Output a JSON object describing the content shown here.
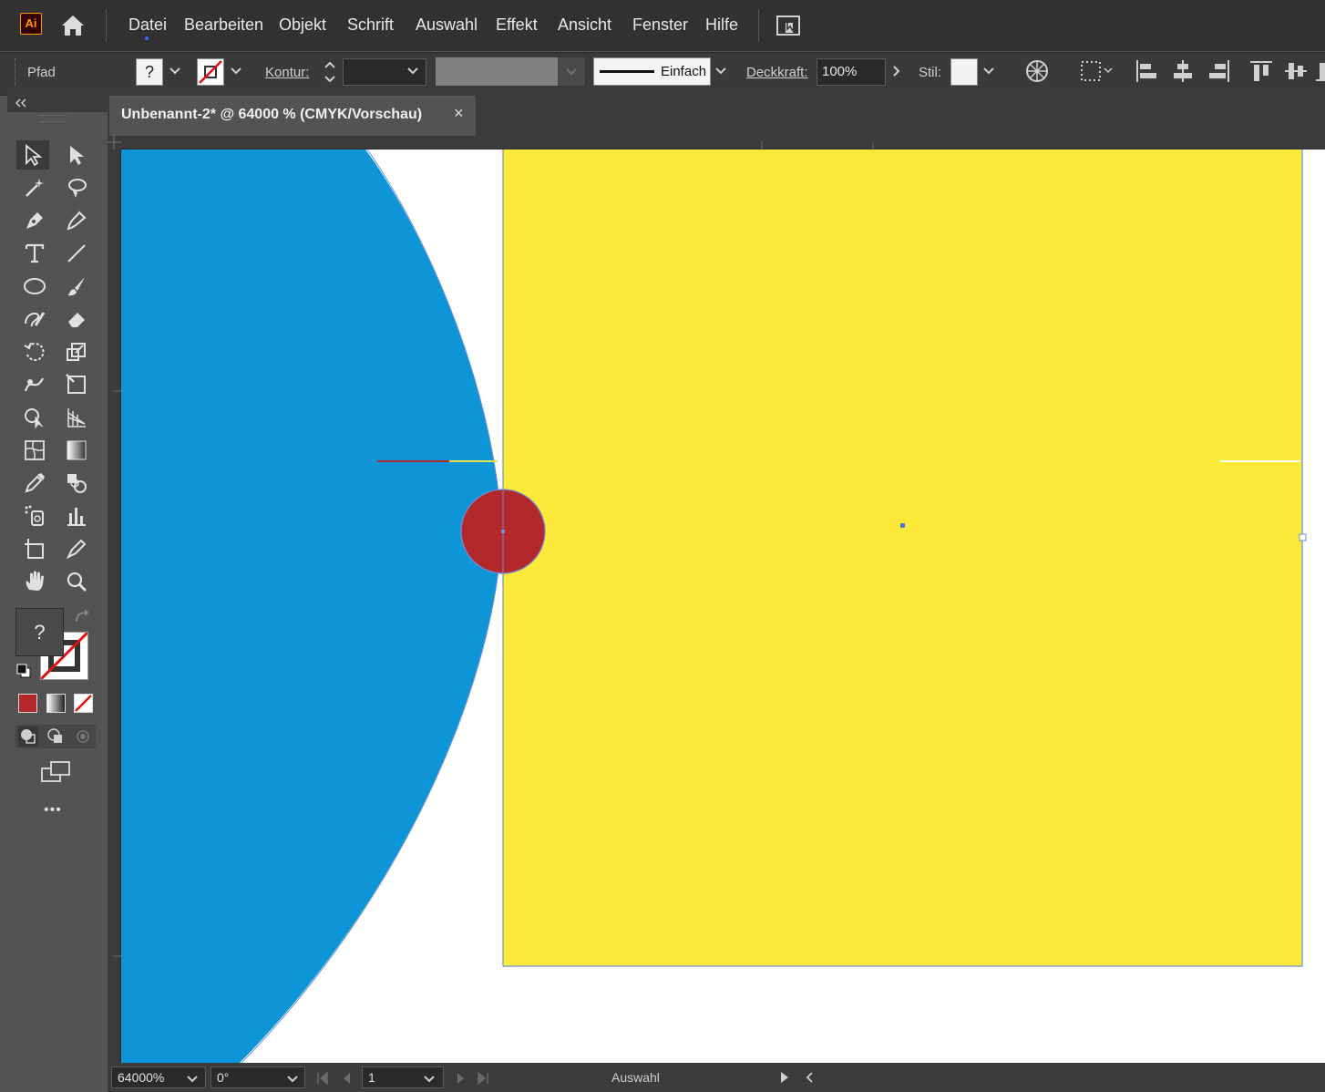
{
  "app": {
    "logo": "Ai"
  },
  "menu": {
    "items": [
      "Datei",
      "Bearbeiten",
      "Objekt",
      "Schrift",
      "Auswahl",
      "Effekt",
      "Ansicht",
      "Fenster",
      "Hilfe"
    ]
  },
  "control": {
    "object_type": "Pfad",
    "fill_value": "?",
    "stroke_label": "Kontur:",
    "stroke_profile": "Einfach",
    "opacity_label": "Deckkraft:",
    "opacity_value": "100%",
    "style_label": "Stil:"
  },
  "document": {
    "tab_title": "Unbenannt-2* @ 64000 % (CMYK/Vorschau)",
    "close_glyph": "×"
  },
  "toolbar": {
    "fill_value": "?",
    "more_glyph": "•••"
  },
  "status": {
    "zoom": "64000%",
    "rotation": "0°",
    "artboard": "1",
    "tool": "Auswahl"
  },
  "colors": {
    "blue": "#0e95d8",
    "yellow": "#fcea3b",
    "red": "#b3282b",
    "accent": "#ff9a00"
  }
}
